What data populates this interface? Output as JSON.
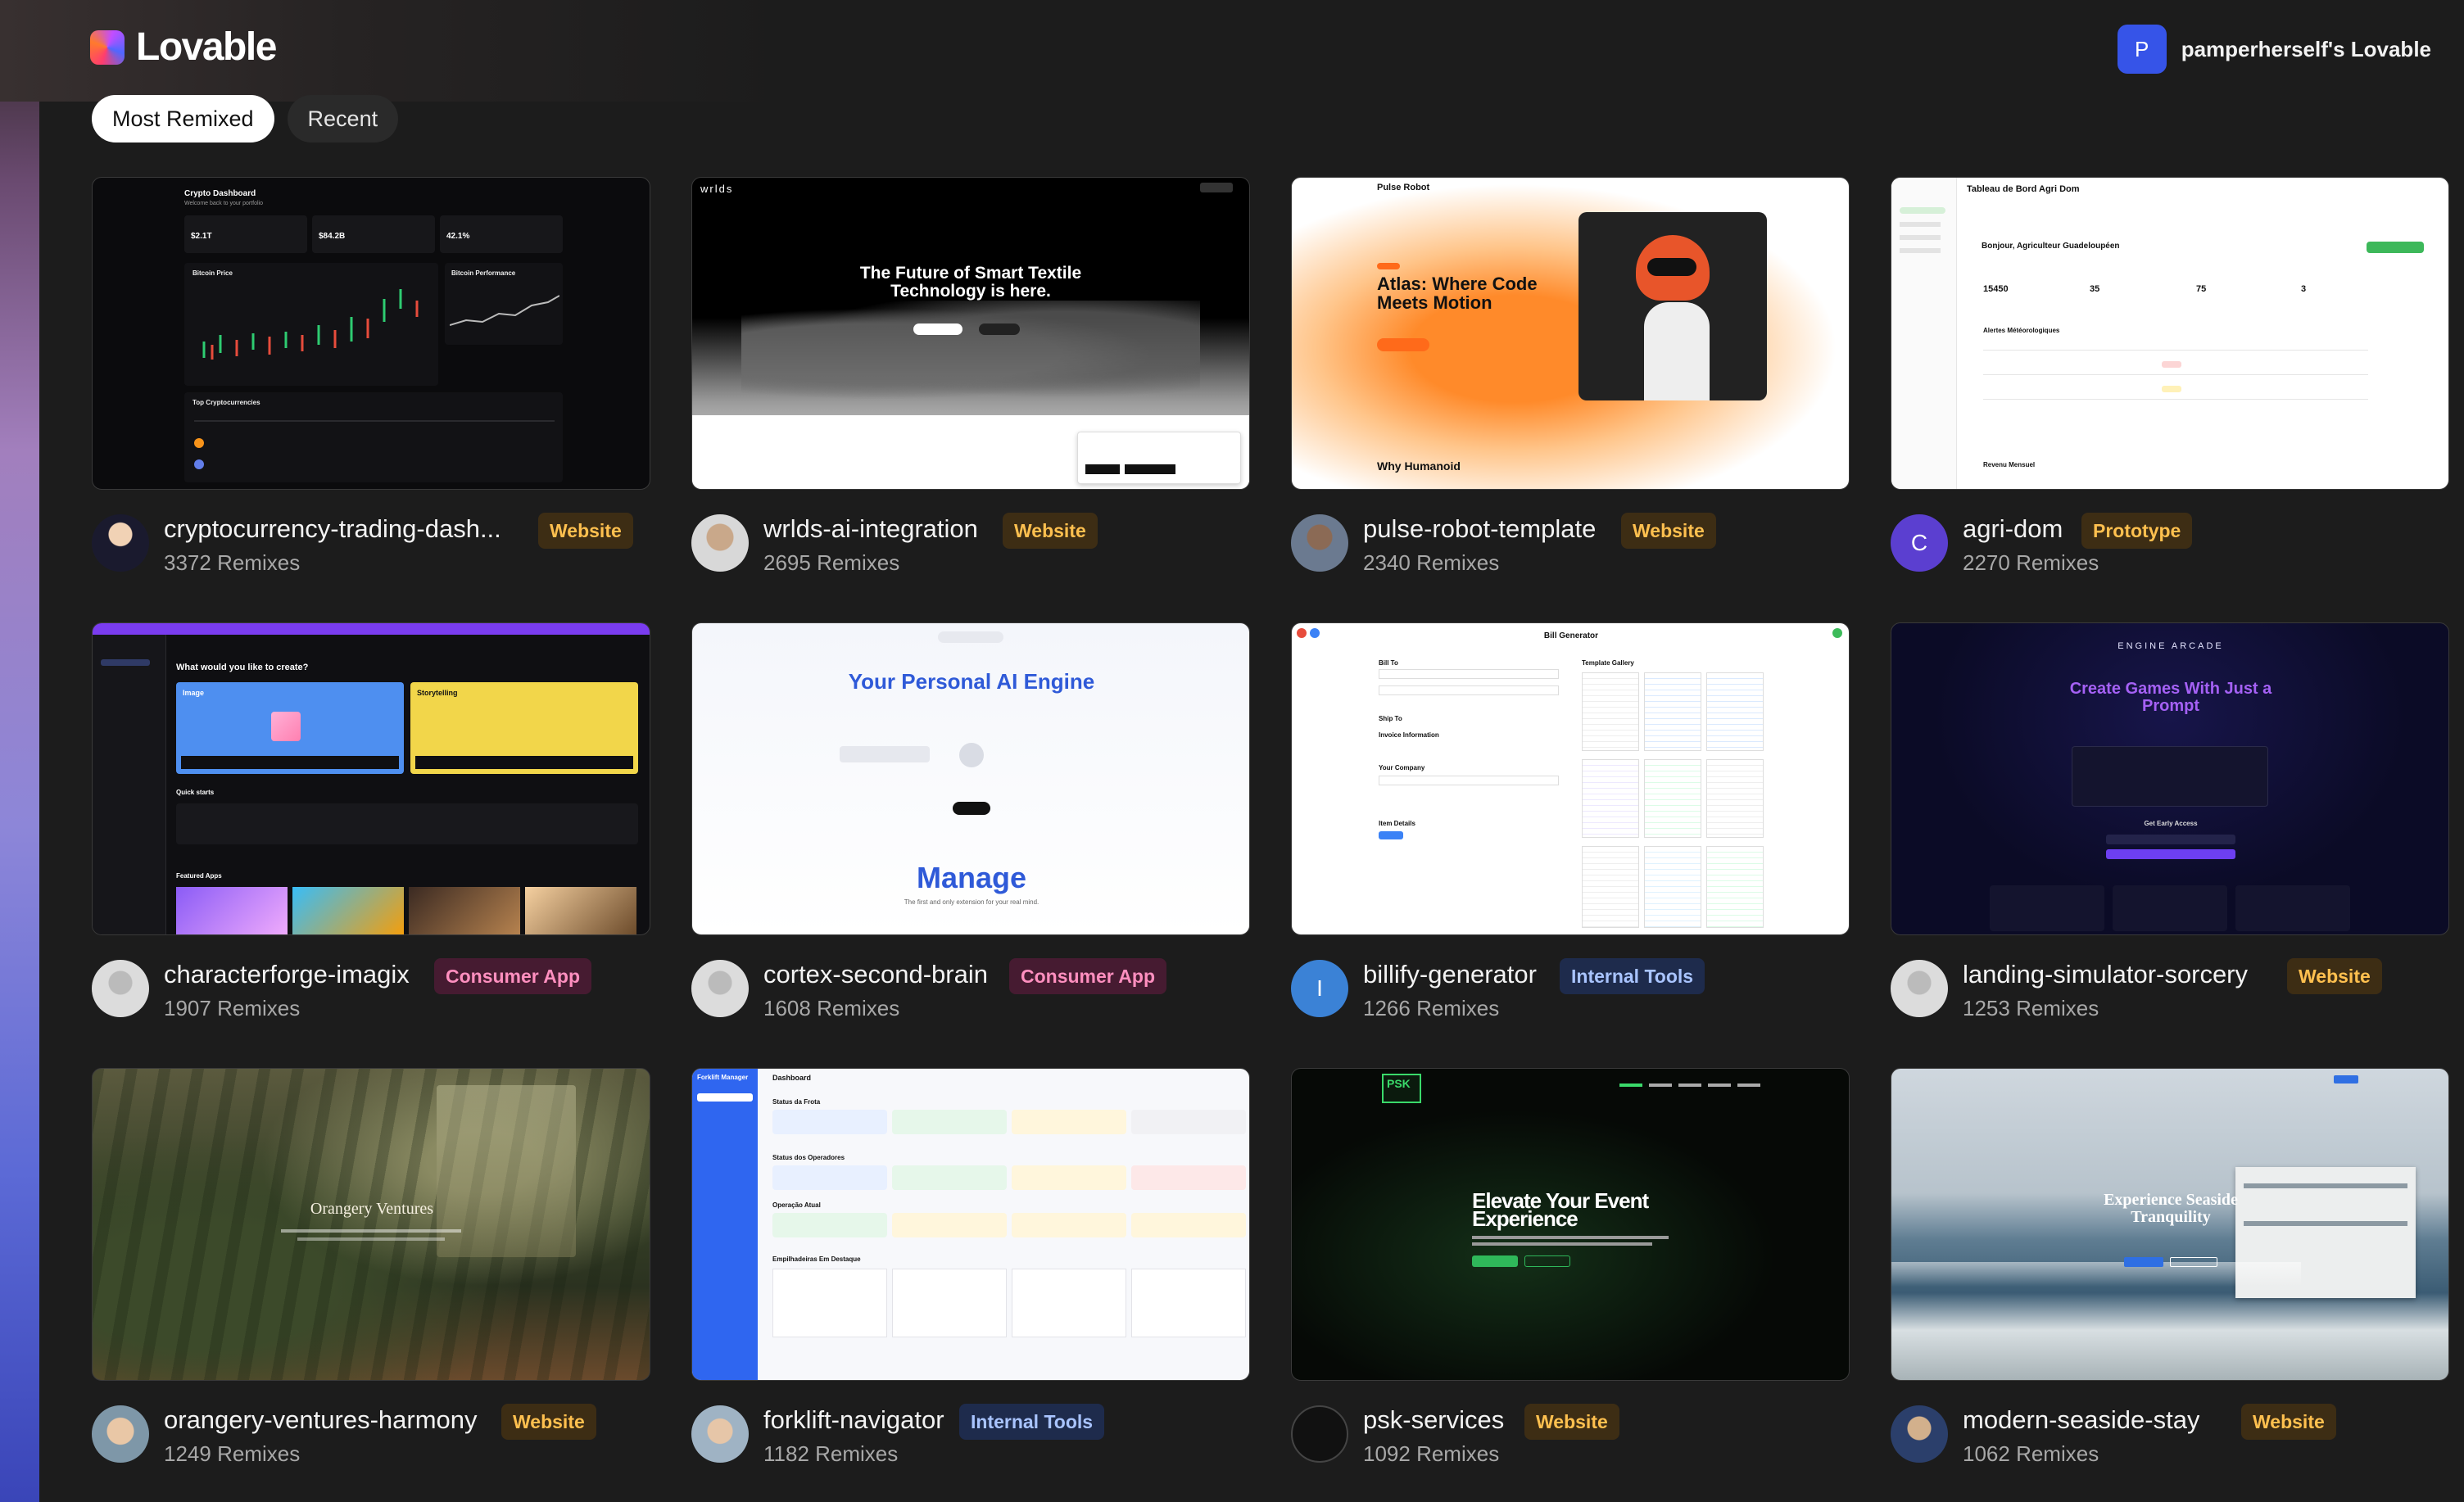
{
  "brand": {
    "name": "Lovable"
  },
  "account": {
    "initial": "P",
    "name": "pamperherself's Lovable"
  },
  "tabs": [
    {
      "label": "Most Remixed",
      "active": true
    },
    {
      "label": "Recent",
      "active": false
    }
  ],
  "colors": {
    "background": "#1c1c1c",
    "website_badge": "#ffc04f",
    "consumer_badge": "#ff8fbf",
    "internal_badge": "#a9c4ff"
  },
  "projects": [
    {
      "name": "cryptocurrency-trading-dash...",
      "category": "Website",
      "remixes": "3372 Remixes",
      "thumb": {
        "title": "Crypto Dashboard",
        "subtitle": "Welcome back to your portfolio",
        "stats": [
          "$2.1T",
          "$84.2B",
          "42.1%"
        ],
        "panel1": "Bitcoin Price",
        "panel2": "Bitcoin Performance",
        "table_title": "Top Cryptocurrencies"
      }
    },
    {
      "name": "wrlds-ai-integration",
      "category": "Website",
      "remixes": "2695 Remixes",
      "thumb": {
        "logo": "wrlds",
        "headline": "The Future of Smart Textile Technology is here."
      }
    },
    {
      "name": "pulse-robot-template",
      "category": "Website",
      "remixes": "2340 Remixes",
      "thumb": {
        "logo": "Pulse Robot",
        "headline": "Atlas: Where Code Meets Motion",
        "footer": "Why Humanoid"
      }
    },
    {
      "name": "agri-dom",
      "category": "Prototype",
      "remixes": "2270 Remixes",
      "author_initial": "C",
      "thumb": {
        "title": "Tableau de Bord Agri Dom",
        "greeting": "Bonjour, Agriculteur Guadeloupéen",
        "stats": [
          "15450",
          "35",
          "75",
          "3"
        ],
        "section": "Alertes Météorologiques",
        "footer": "Revenu Mensuel"
      }
    },
    {
      "name": "characterforge-imagix",
      "category": "Consumer App",
      "remixes": "1907 Remixes",
      "thumb": {
        "question": "What would you like to create?",
        "card1": "Image",
        "card2": "Storytelling",
        "section1": "Quick starts",
        "section2": "Featured Apps"
      }
    },
    {
      "name": "cortex-second-brain",
      "category": "Consumer App",
      "remixes": "1608 Remixes",
      "thumb": {
        "headline": "Your Personal AI Engine",
        "big": "Manage",
        "caption": "The first and only extension for your real mind."
      }
    },
    {
      "name": "billify-generator",
      "category": "Internal Tools",
      "remixes": "1266 Remixes",
      "author_initial": "I",
      "thumb": {
        "title": "Bill Generator",
        "gallery": "Template Gallery",
        "sections": [
          "Bill To",
          "Ship To",
          "Invoice Information",
          "Your Company",
          "Item Details"
        ]
      }
    },
    {
      "name": "landing-simulator-sorcery",
      "category": "Website",
      "remixes": "1253 Remixes",
      "thumb": {
        "eyebrow": "ENGINE ARCADE",
        "headline": "Create Games With Just a Prompt",
        "cta": "Get Early Access"
      }
    },
    {
      "name": "orangery-ventures-harmony",
      "category": "Website",
      "remixes": "1249 Remixes",
      "thumb": {
        "headline": "Orangery Ventures"
      }
    },
    {
      "name": "forklift-navigator",
      "category": "Internal Tools",
      "remixes": "1182 Remixes",
      "thumb": {
        "app": "Forklift Manager",
        "title": "Dashboard",
        "sections": [
          "Status da Frota",
          "Status dos Operadores",
          "Operação Atual",
          "Empilhadeiras Em Destaque"
        ]
      }
    },
    {
      "name": "psk-services",
      "category": "Website",
      "remixes": "1092 Remixes",
      "thumb": {
        "logo": "PSK",
        "headline": "Elevate Your Event Experience"
      }
    },
    {
      "name": "modern-seaside-stay",
      "category": "Website",
      "remixes": "1062 Remixes",
      "thumb": {
        "headline": "Experience Seaside Tranquility"
      }
    }
  ]
}
